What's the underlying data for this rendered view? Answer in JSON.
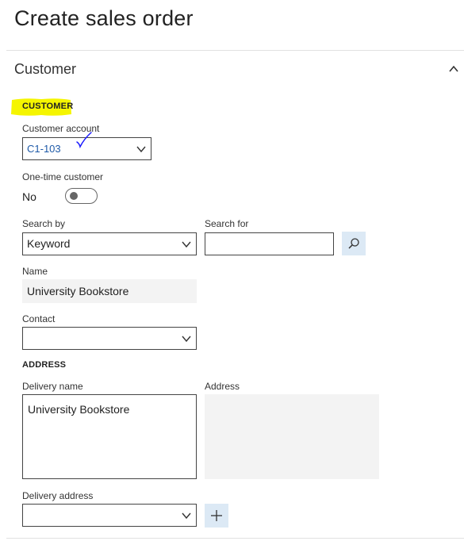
{
  "page": {
    "title": "Create sales order"
  },
  "section": {
    "title": "Customer"
  },
  "customer_group": {
    "heading": "CUSTOMER",
    "customer_account": {
      "label": "Customer account",
      "value": "C1-103"
    },
    "one_time": {
      "label": "One-time customer",
      "state_text": "No"
    },
    "search_by": {
      "label": "Search by",
      "value": "Keyword"
    },
    "search_for": {
      "label": "Search for",
      "value": ""
    },
    "name": {
      "label": "Name",
      "value": "University Bookstore"
    },
    "contact": {
      "label": "Contact",
      "value": ""
    }
  },
  "address_group": {
    "heading": "ADDRESS",
    "delivery_name": {
      "label": "Delivery name",
      "value": "University Bookstore"
    },
    "address": {
      "label": "Address",
      "value": ""
    },
    "delivery_address": {
      "label": "Delivery address",
      "value": ""
    }
  },
  "colors": {
    "highlight": "#f5f500",
    "link": "#1e5aa8",
    "checkmark": "#1a1aff",
    "icon_button_bg": "#dce9f5"
  },
  "icons": [
    "chevron-up-icon",
    "chevron-down-icon",
    "search-icon",
    "plus-icon",
    "checkmark-annotation-icon"
  ]
}
